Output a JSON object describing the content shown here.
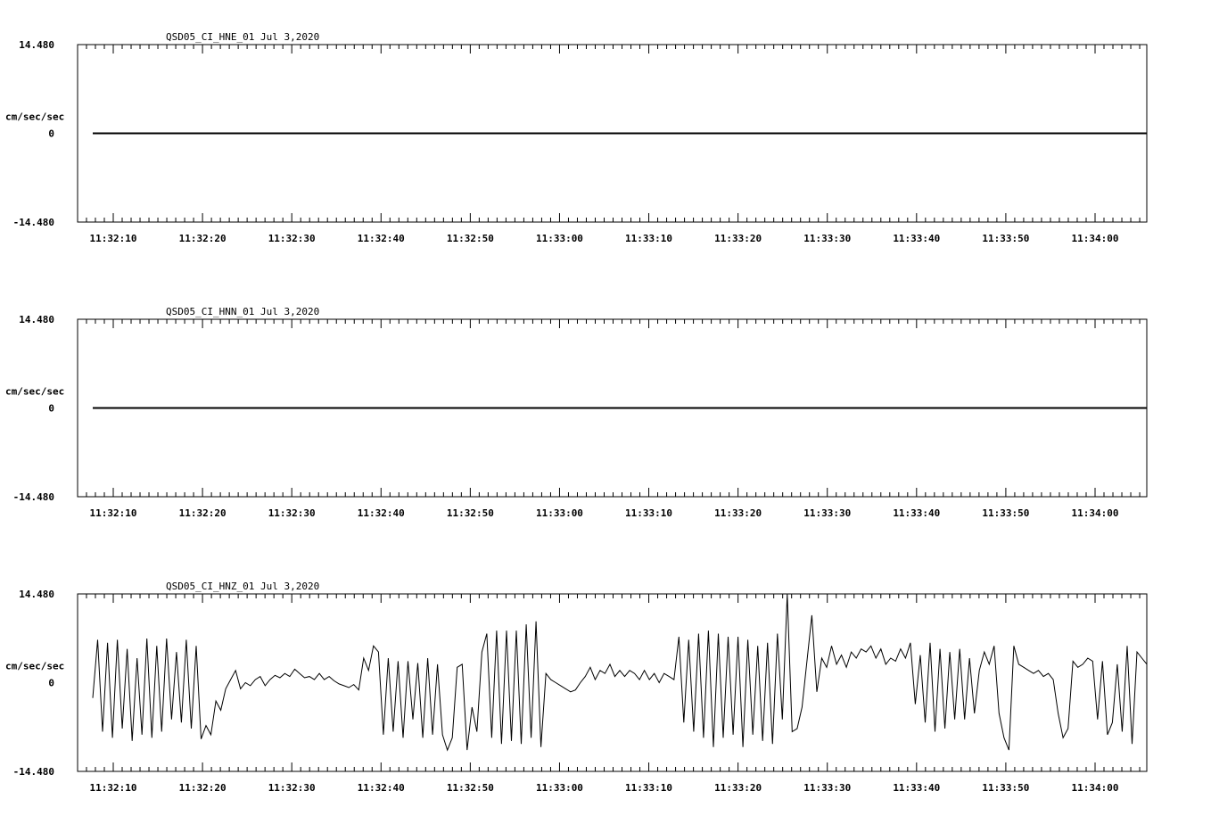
{
  "chart_data": [
    {
      "type": "line",
      "title": "QSD05_CI_HNE_01  Jul 3,2020",
      "ylabel": "cm/sec/sec",
      "ylim": [
        -14.48,
        14.48
      ],
      "y_ticks": [
        {
          "value": 14.48,
          "label": "14.480"
        },
        {
          "value": 0,
          "label": "0"
        },
        {
          "value": -14.48,
          "label": "-14.480"
        }
      ],
      "x_ticks": [
        "11:32:10",
        "11:32:20",
        "11:32:30",
        "11:32:40",
        "11:32:50",
        "11:33:00",
        "11:33:10",
        "11:33:20",
        "11:33:30",
        "11:33:40",
        "11:33:50",
        "11:34:00"
      ],
      "series": [
        {
          "x_start": "11:32:07.7",
          "x_end": "11:34:05.8",
          "values": [
            0,
            0
          ]
        }
      ]
    },
    {
      "type": "line",
      "title": "QSD05_CI_HNN_01  Jul 3,2020",
      "ylabel": "cm/sec/sec",
      "ylim": [
        -14.48,
        14.48
      ],
      "y_ticks": [
        {
          "value": 14.48,
          "label": "14.480"
        },
        {
          "value": 0,
          "label": "0"
        },
        {
          "value": -14.48,
          "label": "-14.480"
        }
      ],
      "x_ticks": [
        "11:32:10",
        "11:32:20",
        "11:32:30",
        "11:32:40",
        "11:32:50",
        "11:33:00",
        "11:33:10",
        "11:33:20",
        "11:33:30",
        "11:33:40",
        "11:33:50",
        "11:34:00"
      ],
      "series": [
        {
          "x_start": "11:32:07.7",
          "x_end": "11:34:05.8",
          "values": [
            0,
            0
          ]
        }
      ]
    },
    {
      "type": "line",
      "title": "QSD05_CI_HNZ_01  Jul 3,2020",
      "ylabel": "cm/sec/sec",
      "ylim": [
        -14.48,
        14.48
      ],
      "y_ticks": [
        {
          "value": 14.48,
          "label": "14.480"
        },
        {
          "value": 0,
          "label": "0"
        },
        {
          "value": -14.48,
          "label": "-14.480"
        }
      ],
      "x_ticks": [
        "11:32:10",
        "11:32:20",
        "11:32:30",
        "11:32:40",
        "11:32:50",
        "11:33:00",
        "11:33:10",
        "11:33:20",
        "11:33:30",
        "11:33:40",
        "11:33:50",
        "11:34:00"
      ],
      "series": [
        {
          "x_start": "11:32:07.7",
          "x_end": "11:34:05.8",
          "values": [
            -2.5,
            7.0,
            -8.0,
            6.5,
            -9.0,
            7.0,
            -7.5,
            5.5,
            -9.5,
            4.0,
            -8.5,
            7.2,
            -9.0,
            6.0,
            -8.0,
            7.2,
            -6.0,
            5.0,
            -6.5,
            7.0,
            -7.5,
            6.0,
            -9.2,
            -7.0,
            -8.5,
            -3.0,
            -4.5,
            -1.0,
            0.5,
            2.0,
            -1.0,
            0.0,
            -0.5,
            0.5,
            1.0,
            -0.5,
            0.5,
            1.2,
            0.8,
            1.5,
            1.0,
            2.2,
            1.5,
            0.8,
            1.0,
            0.5,
            1.5,
            0.5,
            1.0,
            0.3,
            -0.2,
            -0.5,
            -0.8,
            -0.3,
            -1.2,
            4.0,
            2.0,
            6.0,
            5.0,
            -8.5,
            4.0,
            -8.0,
            3.5,
            -9.0,
            3.5,
            -6.0,
            3.2,
            -9.0,
            4.0,
            -8.5,
            3.0,
            -8.5,
            -11.0,
            -9.0,
            2.5,
            3.0,
            -11.0,
            -4.0,
            -8.0,
            5.0,
            8.0,
            -9.0,
            8.5,
            -10.0,
            8.5,
            -9.5,
            8.5,
            -10.0,
            9.5,
            -9.0,
            10.0,
            -10.5,
            1.5,
            0.5,
            0.0,
            -0.5,
            -1.0,
            -1.5,
            -1.2,
            0.0,
            1.0,
            2.5,
            0.5,
            2.0,
            1.5,
            3.0,
            1.0,
            2.0,
            1.0,
            2.0,
            1.5,
            0.5,
            2.0,
            0.5,
            1.5,
            0.0,
            1.5,
            1.0,
            0.5,
            7.5,
            -6.5,
            7.0,
            -8.0,
            8.0,
            -9.0,
            8.5,
            -10.5,
            8.0,
            -9.0,
            7.5,
            -8.5,
            7.5,
            -10.5,
            7.0,
            -8.5,
            6.0,
            -9.5,
            6.5,
            -10.0,
            8.0,
            -6.0,
            14.5,
            -8.0,
            -7.5,
            -4.0,
            3.5,
            11.0,
            -1.5,
            4.0,
            2.5,
            6.0,
            3.0,
            4.5,
            2.5,
            5.0,
            4.0,
            5.5,
            5.0,
            6.0,
            4.0,
            5.5,
            3.0,
            4.0,
            3.5,
            5.5,
            4.0,
            6.5,
            -3.5,
            4.5,
            -6.5,
            6.5,
            -8.0,
            5.5,
            -7.5,
            5.0,
            -6.0,
            5.5,
            -6.0,
            4.0,
            -5.0,
            2.0,
            5.0,
            3.0,
            6.0,
            -5.0,
            -9.0,
            -11.0,
            6.0,
            3.0,
            2.5,
            2.0,
            1.5,
            2.0,
            1.0,
            1.5,
            0.5,
            -5.0,
            -9.0,
            -7.5,
            3.5,
            2.5,
            3.0,
            4.0,
            3.5,
            -6.0,
            3.5,
            -8.5,
            -6.5,
            3.0,
            -8.0,
            6.0,
            -10.0,
            5.0,
            4.0,
            3.0
          ]
        }
      ]
    }
  ]
}
